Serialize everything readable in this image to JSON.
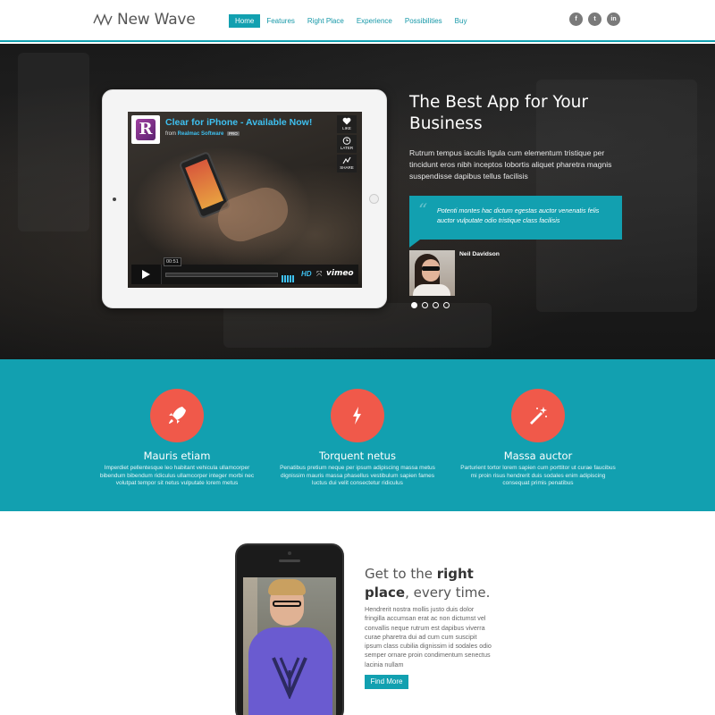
{
  "header": {
    "brand": "New Wave",
    "nav": [
      {
        "label": "Home",
        "active": true
      },
      {
        "label": "Features",
        "active": false
      },
      {
        "label": "Right Place",
        "active": false
      },
      {
        "label": "Experience",
        "active": false
      },
      {
        "label": "Possibilities",
        "active": false
      },
      {
        "label": "Buy",
        "active": false
      }
    ],
    "social": [
      {
        "label": "f",
        "icon": "facebook-icon"
      },
      {
        "label": "t",
        "icon": "twitter-icon"
      },
      {
        "label": "in",
        "icon": "linkedin-icon"
      }
    ]
  },
  "hero": {
    "video": {
      "title": "Clear for iPhone - Available Now!",
      "from_prefix": "from",
      "from_author": "Realmac Software",
      "badge": "PRO",
      "side_buttons": [
        "LIKE",
        "LATER",
        "SHARE"
      ],
      "time": "00:51",
      "hd": "HD",
      "brand": "vimeo"
    },
    "title": "The Best App for Your Business",
    "text": "Rutrum tempus iaculis ligula cum elementum tristique per tincidunt eros nibh inceptos lobortis aliquet pharetra magnis suspendisse dapibus tellus facilisis",
    "quote": "Potenti montes hac dictum egestas auctor venenatis felis auctor vulputate odio tristique class facilisis",
    "author": "Neil Davidson",
    "slides": 4,
    "active_slide": 1
  },
  "features": [
    {
      "title": "Mauris etiam",
      "text": "Imperdiet pellentesque leo habitant vehicula ullamcorper bibendum bibendum ridiculus ullamcorper integer morbi nec volutpat tempor sit netus vulputate lorem metus",
      "icon": "rocket-icon"
    },
    {
      "title": "Torquent netus",
      "text": "Penatibus pretium neque per ipsum adipiscing massa metus dignissim mauris massa phasellus vestibulum sapien fames luctus dui velit consectetur ridiculus",
      "icon": "lightning-icon"
    },
    {
      "title": "Massa auctor",
      "text": "Parturient tortor lorem sapien cum porttitor ut curae faucibus mi proin risus hendrerit duis sodales enim adipiscing consequat primis penatibus",
      "icon": "magic-wand-icon"
    }
  ],
  "section": {
    "title_pre": "Get to the ",
    "title_bold1": "right",
    "title_bold2": "place",
    "title_post": ", every time.",
    "text": "Hendrerit nostra mollis justo duis dolor fringilla accumsan erat ac non dictumst vel convallis neque rutrum est dapibus viverra curae pharetra dui ad cum cum suscipit ipsum class cubilia dignissim id sodales odio semper ornare proin condimentum senectus lacinia nullam",
    "button": "Find More"
  },
  "colors": {
    "accent": "#12a0b0",
    "feature_icon": "#f0594a",
    "link": "#3ec0f0"
  }
}
